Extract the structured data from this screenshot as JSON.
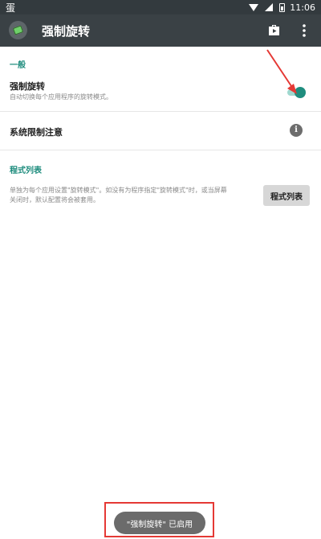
{
  "status_bar": {
    "left_icon": "蛋",
    "time": "11:06",
    "icons": [
      "wifi-icon",
      "signal-icon",
      "battery-icon"
    ]
  },
  "app_bar": {
    "title": "强制旋转",
    "icons": [
      "app-logo-icon",
      "play-store-icon",
      "more-vert-icon"
    ]
  },
  "general_section": {
    "header": "一般",
    "force_rotation": {
      "title": "强制旋转",
      "summary": "自动切换每个应用程序的旋转模式。",
      "enabled": true
    },
    "system_limits": {
      "title": "系统限制注意"
    }
  },
  "app_list_section": {
    "header": "程式列表",
    "summary_line1": "单独为每个应用设置\"旋转模式\"。如没有为程序指定\"旋转模式\"时，或当屏幕",
    "summary_line2": "关闭时，默认配置将会被套用。",
    "button_label": "程式列表"
  },
  "toast": {
    "message": "\"强制旋转\" 已启用"
  },
  "colors": {
    "status_bar": "#333a3e",
    "app_bar": "#3a4145",
    "accent": "#1f8d7e",
    "annotation": "#e53935"
  }
}
